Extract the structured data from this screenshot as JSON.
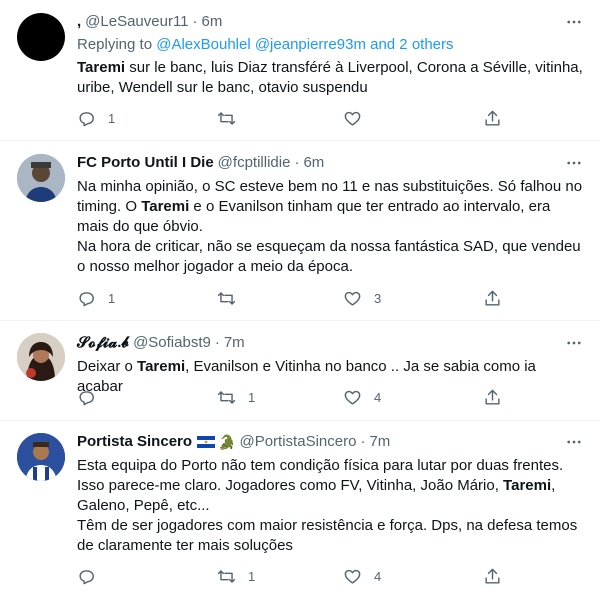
{
  "tweets": [
    {
      "name": ",",
      "handle": "@LeSauveur11",
      "dot": "·",
      "time": "6m",
      "reply_prefix": "Replying to ",
      "reply_users": "@AlexBouhlel @jeanpierre93m and 2 others",
      "lines": [
        "Taremi sur le banc, luis Diaz transféré à Liverpool, Corona a Séville, vitinha,",
        "uribe, Wendell sur le banc, otavio suspendu"
      ],
      "replies": "1",
      "retweets": "",
      "likes": "",
      "avatar_color": "#000000"
    },
    {
      "name": "FC Porto Until I Die",
      "handle": "@fcptillidie",
      "dot": "·",
      "time": "6m",
      "lines": [
        "Na minha opinião, o SC esteve bem no 11 e nas substituições. Só falhou no",
        "timing. O Taremi e o Evanilson tinham que ter entrado ao intervalo, era",
        "mais do que óbvio.",
        "Na hora de criticar, não se esqueçam da nossa fantástica SAD, que vendeu",
        "o nosso melhor jogador a meio da época."
      ],
      "replies": "1",
      "retweets": "",
      "likes": "3",
      "avatar_color": "#7f8da0"
    },
    {
      "name": "𝓢𝓸𝓯𝓲𝓪.𝓫",
      "handle": "@Sofiabst9",
      "dot": "·",
      "time": "7m",
      "lines": [
        "Deixar o Taremi, Evanilson e Vitinha no banco .. Ja se sabia como ia acabar"
      ],
      "replies": "",
      "retweets": "1",
      "likes": "4",
      "avatar_color": "#6b3a2a"
    },
    {
      "name": "Portista Sincero",
      "handle": "@PortistaSincero",
      "dot": "·",
      "time": "7m",
      "lines": [
        "Esta equipa do Porto não tem condição física para lutar por duas frentes.",
        "Isso parece-me claro. Jogadores como FV, Vitinha, João Mário, Taremi,",
        "Galeno, Pepê, etc...",
        "Têm de ser jogadores com maior resistência e força. Dps, na defesa temos",
        "de claramente ter mais soluções"
      ],
      "replies": "",
      "retweets": "1",
      "likes": "4",
      "avatar_color": "#1b3f8c"
    }
  ],
  "icons": {
    "more": "more-icon",
    "reply": "reply-icon",
    "retweet": "retweet-icon",
    "like": "heart-icon",
    "share": "share-icon"
  },
  "colors": {
    "link": "#1d9bf0",
    "secondary": "#536471",
    "text": "#0f1419",
    "divider": "#eff3f4"
  }
}
